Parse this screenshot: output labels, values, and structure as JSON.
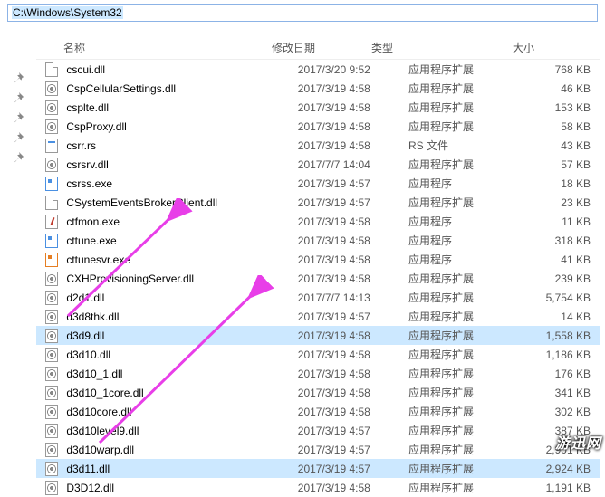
{
  "address_bar": {
    "path": "C:\\Windows\\System32"
  },
  "columns": {
    "name": "名称",
    "date": "修改日期",
    "type": "类型",
    "size": "大小"
  },
  "pins_count": 5,
  "files": [
    {
      "icon": "page",
      "name": "cscui.dll",
      "date": "2017/3/20 9:52",
      "type": "应用程序扩展",
      "size": "768 KB",
      "sel": false
    },
    {
      "icon": "gear",
      "name": "CspCellularSettings.dll",
      "date": "2017/3/19 4:58",
      "type": "应用程序扩展",
      "size": "46 KB",
      "sel": false
    },
    {
      "icon": "gear",
      "name": "csplte.dll",
      "date": "2017/3/19 4:58",
      "type": "应用程序扩展",
      "size": "153 KB",
      "sel": false
    },
    {
      "icon": "gear",
      "name": "CspProxy.dll",
      "date": "2017/3/19 4:58",
      "type": "应用程序扩展",
      "size": "58 KB",
      "sel": false
    },
    {
      "icon": "cfg",
      "name": "csrr.rs",
      "date": "2017/3/19 4:58",
      "type": "RS 文件",
      "size": "43 KB",
      "sel": false
    },
    {
      "icon": "gear",
      "name": "csrsrv.dll",
      "date": "2017/7/7 14:04",
      "type": "应用程序扩展",
      "size": "57 KB",
      "sel": false
    },
    {
      "icon": "exe-b",
      "name": "csrss.exe",
      "date": "2017/3/19 4:57",
      "type": "应用程序",
      "size": "18 KB",
      "sel": false
    },
    {
      "icon": "page",
      "name": "CSystemEventsBrokerClient.dll",
      "date": "2017/3/19 4:57",
      "type": "应用程序扩展",
      "size": "23 KB",
      "sel": false
    },
    {
      "icon": "pen",
      "name": "ctfmon.exe",
      "date": "2017/3/19 4:58",
      "type": "应用程序",
      "size": "11 KB",
      "sel": false
    },
    {
      "icon": "exe-b",
      "name": "cttune.exe",
      "date": "2017/3/19 4:58",
      "type": "应用程序",
      "size": "318 KB",
      "sel": false
    },
    {
      "icon": "exe-o",
      "name": "cttunesvr.exe",
      "date": "2017/3/19 4:58",
      "type": "应用程序",
      "size": "41 KB",
      "sel": false
    },
    {
      "icon": "gear",
      "name": "CXHProvisioningServer.dll",
      "date": "2017/3/19 4:58",
      "type": "应用程序扩展",
      "size": "239 KB",
      "sel": false
    },
    {
      "icon": "gear",
      "name": "d2d1.dll",
      "date": "2017/7/7 14:13",
      "type": "应用程序扩展",
      "size": "5,754 KB",
      "sel": false
    },
    {
      "icon": "gear",
      "name": "d3d8thk.dll",
      "date": "2017/3/19 4:57",
      "type": "应用程序扩展",
      "size": "14 KB",
      "sel": false
    },
    {
      "icon": "gear",
      "name": "d3d9.dll",
      "date": "2017/3/19 4:58",
      "type": "应用程序扩展",
      "size": "1,558 KB",
      "sel": true
    },
    {
      "icon": "gear",
      "name": "d3d10.dll",
      "date": "2017/3/19 4:58",
      "type": "应用程序扩展",
      "size": "1,186 KB",
      "sel": false
    },
    {
      "icon": "gear",
      "name": "d3d10_1.dll",
      "date": "2017/3/19 4:58",
      "type": "应用程序扩展",
      "size": "176 KB",
      "sel": false
    },
    {
      "icon": "gear",
      "name": "d3d10_1core.dll",
      "date": "2017/3/19 4:58",
      "type": "应用程序扩展",
      "size": "341 KB",
      "sel": false
    },
    {
      "icon": "gear",
      "name": "d3d10core.dll",
      "date": "2017/3/19 4:58",
      "type": "应用程序扩展",
      "size": "302 KB",
      "sel": false
    },
    {
      "icon": "gear",
      "name": "d3d10level9.dll",
      "date": "2017/3/19 4:57",
      "type": "应用程序扩展",
      "size": "387 KB",
      "sel": false
    },
    {
      "icon": "gear",
      "name": "d3d10warp.dll",
      "date": "2017/3/19 4:57",
      "type": "应用程序扩展",
      "size": "2,901 KB",
      "sel": false
    },
    {
      "icon": "gear",
      "name": "d3d11.dll",
      "date": "2017/3/19 4:57",
      "type": "应用程序扩展",
      "size": "2,924 KB",
      "sel": true
    },
    {
      "icon": "gear",
      "name": "D3D12.dll",
      "date": "2017/3/19 4:58",
      "type": "应用程序扩展",
      "size": "1,191 KB",
      "sel": false
    }
  ],
  "watermark": "游迅网"
}
